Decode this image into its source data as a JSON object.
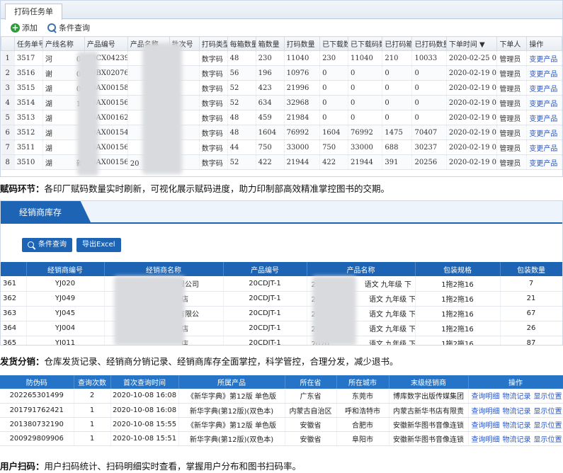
{
  "panel1": {
    "tab_label": "打码任务单",
    "toolbar": {
      "add_label": "添加",
      "query_label": "条件查询"
    },
    "columns": [
      "",
      "任务单号",
      "产线名称",
      "产品编号",
      "产品名称",
      "批次号",
      "打码类型",
      "每箱数量",
      "箱数量",
      "打码数量",
      "已下载数",
      "已下载码数",
      "已打码箱数",
      "已打码数量",
      "下单时间 ▼",
      "下单人",
      "操作"
    ],
    "rows": [
      [
        "1",
        "3517",
        "河",
        "01",
        "20CX0423931",
        "",
        "",
        "数字码",
        "48",
        "230",
        "11040",
        "230",
        "11040",
        "210",
        "10033",
        "2020-02-25 09",
        "管理员",
        "变更产品"
      ],
      [
        "2",
        "3516",
        "谢",
        "01",
        "20BX0207631",
        "",
        "",
        "数字码",
        "56",
        "196",
        "10976",
        "0",
        "0",
        "0",
        "0",
        "2020-02-19 09",
        "管理员",
        "变更产品"
      ],
      [
        "3",
        "3515",
        "湖",
        "01",
        "20AX0015831",
        "",
        "",
        "数字码",
        "52",
        "423",
        "21996",
        "0",
        "0",
        "0",
        "0",
        "2020-02-19 05",
        "管理员",
        "变更产品"
      ],
      [
        "4",
        "3514",
        "湖",
        "1",
        "20AX0015631",
        "",
        "",
        "数字码",
        "52",
        "634",
        "32968",
        "0",
        "0",
        "0",
        "0",
        "2020-02-19 06",
        "管理员",
        "变更产品"
      ],
      [
        "5",
        "3513",
        "湖",
        "",
        "20AX0016231",
        "",
        "",
        "数字码",
        "48",
        "459",
        "21984",
        "0",
        "0",
        "0",
        "0",
        "2020-02-19 08",
        "管理员",
        "变更产品"
      ],
      [
        "6",
        "3512",
        "湖",
        "",
        "20AX0015431",
        "",
        "",
        "数字码",
        "48",
        "1604",
        "76992",
        "1604",
        "76992",
        "1475",
        "70407",
        "2020-02-19 08",
        "管理员",
        "变更产品"
      ],
      [
        "7",
        "3511",
        "湖",
        "",
        "20AX0015631",
        "",
        "",
        "数字码",
        "44",
        "750",
        "33000",
        "750",
        "33000",
        "688",
        "30237",
        "2020-02-19 08",
        "管理员",
        "变更产品"
      ],
      [
        "8",
        "3510",
        "湖",
        "新",
        "20AX0015636",
        "20",
        "店",
        "数字码",
        "52",
        "422",
        "21944",
        "422",
        "21944",
        "391",
        "20256",
        "2020-02-19 09",
        "管理员",
        "变更产品"
      ]
    ]
  },
  "caption1": {
    "label": "赋码环节：",
    "text": "各印厂赋码数量实时刷新，可视化展示赋码进度，助力印制部高效精准掌控图书的交期。"
  },
  "panel2": {
    "title": "经销商库存",
    "query_button": "条件查询",
    "export_button": "导出Excel",
    "columns": [
      "",
      "经销商编号",
      "经销商名称",
      "产品编号",
      "产品名称",
      "包装规格",
      "包装数量"
    ],
    "rows": [
      [
        "361",
        "YJ020",
        "有限公司",
        "20CDJT-1",
        "202",
        "语文 九年级 下",
        "1拖2拖16",
        "7"
      ],
      [
        "362",
        "YJ049",
        "店",
        "20CDJT-1",
        "2020",
        "语文 九年级 下",
        "1拖2拖16",
        "21"
      ],
      [
        "363",
        "YJ045",
        "长",
        "有限公",
        "20CDJT-1",
        "2020",
        "语文 九年级 下",
        "1拖2拖16",
        "67"
      ],
      [
        "364",
        "YJ004",
        "",
        "店",
        "20CDJT-1",
        "2020",
        "语文 九年级 下",
        "1拖2拖16",
        "26"
      ],
      [
        "365",
        "YJ011",
        "",
        "店",
        "20CDJT-1",
        "2020",
        "语文 九年级 下",
        "1拖2拖16",
        "87"
      ]
    ]
  },
  "caption2": {
    "label": "发货分销：",
    "text": "仓库发货记录、经销商分销记录、经销商库存全面掌控，科学管控，合理分发，减少退书。"
  },
  "panel3": {
    "columns": [
      "防伪码",
      "查询次数",
      "首次查询时间",
      "所属产品",
      "所在省",
      "所在城市",
      "末级经销商",
      "操作"
    ],
    "rows": [
      [
        "202265301499",
        "2",
        "2020-10-08 16:08",
        "《新华字典》第12版 单色版",
        "广东省",
        "东莞市",
        "博库数字出版传媒集团"
      ],
      [
        "201791762421",
        "1",
        "2020-10-08 16:08",
        "新华字典(第12版)(双色本)",
        "内蒙古自治区",
        "呼和浩特市",
        "内蒙古新华书店有限责"
      ],
      [
        "201380732190",
        "1",
        "2020-10-08 15:55",
        "《新华字典》第12版 单色版",
        "安徽省",
        "合肥市",
        "安徽新华图书音像连锁"
      ],
      [
        "200929809906",
        "1",
        "2020-10-08 15:51",
        "新华字典(第12版)(双色本)",
        "安徽省",
        "阜阳市",
        "安徽新华图书音像连锁"
      ]
    ],
    "ops": [
      "查询明细",
      "物流记录",
      "显示位置"
    ]
  },
  "caption3": {
    "label": "用户扫码：",
    "text": "用户扫码统计、扫码明细实时查看，掌握用户分布和图书扫码率。"
  }
}
